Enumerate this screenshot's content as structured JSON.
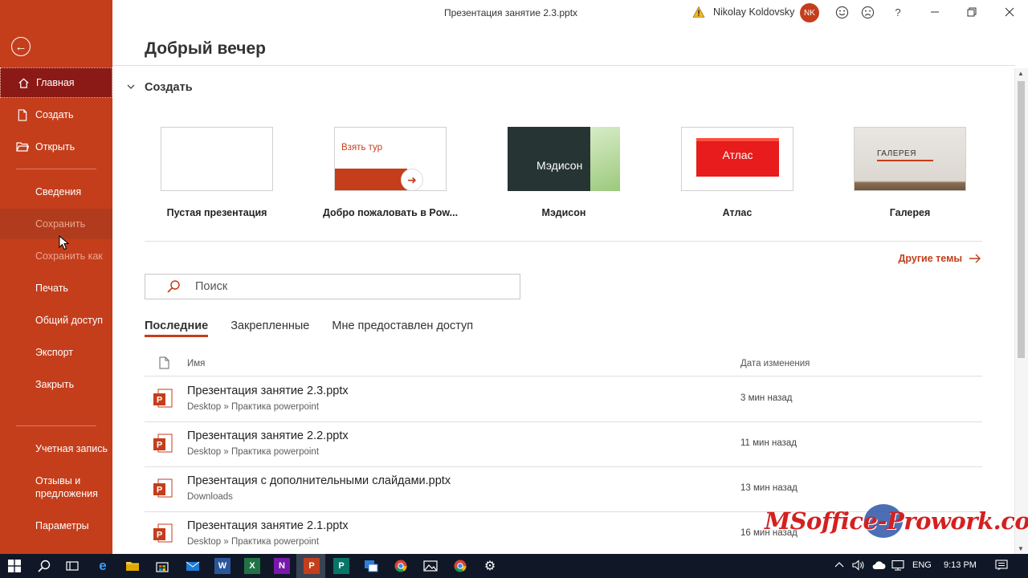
{
  "window": {
    "title": "Презентация занятие 2.3.pptx",
    "user_name": "Nikolay Koldovsky",
    "user_initials": "NK",
    "icons": [
      "warning-icon",
      "smile-icon",
      "frown-icon",
      "help-icon",
      "minimize-icon",
      "restore-icon",
      "close-icon"
    ]
  },
  "sidebar": {
    "items": [
      {
        "label": "Главная",
        "icon": "home-icon"
      },
      {
        "label": "Создать",
        "icon": "new-document-icon"
      },
      {
        "label": "Открыть",
        "icon": "folder-open-icon"
      },
      {
        "label": "Сведения"
      },
      {
        "label": "Сохранить"
      },
      {
        "label": "Сохранить как"
      },
      {
        "label": "Печать"
      },
      {
        "label": "Общий доступ"
      },
      {
        "label": "Экспорт"
      },
      {
        "label": "Закрыть"
      },
      {
        "label": "Учетная запись"
      },
      {
        "label": "Отзывы и предложения"
      },
      {
        "label": "Параметры"
      }
    ]
  },
  "main": {
    "greeting": "Добрый вечер",
    "create_section": "Создать",
    "templates": [
      {
        "caption": "Пустая презентация"
      },
      {
        "caption": "Добро пожаловать в Pow...",
        "thumb_text": "Взять тур"
      },
      {
        "caption": "Мэдисон",
        "thumb_text": "Мэдисон"
      },
      {
        "caption": "Атлас",
        "thumb_text": "Атлас"
      },
      {
        "caption": "Галерея",
        "thumb_text": "ГАЛЕРЕЯ"
      }
    ],
    "more_themes": "Другие темы",
    "search_placeholder": "Поиск",
    "tabs": [
      "Последние",
      "Закрепленные",
      "Мне предоставлен доступ"
    ],
    "list_headers": {
      "name": "Имя",
      "date": "Дата изменения"
    },
    "files": [
      {
        "name": "Презентация занятие 2.3.pptx",
        "path": "Desktop » Практика powerpoint",
        "date": "3 мин назад"
      },
      {
        "name": "Презентация занятие 2.2.pptx",
        "path": "Desktop » Практика powerpoint",
        "date": "11 мин назад"
      },
      {
        "name": "Презентация с дополнительными слайдами.pptx",
        "path": "Downloads",
        "date": "13 мин назад"
      },
      {
        "name": "Презентация занятие 2.1.pptx",
        "path": "Desktop » Практика powerpoint",
        "date": "16 мин назад"
      }
    ]
  },
  "watermark": "MSoffice-Prowork.com",
  "taskbar": {
    "language": "ENG",
    "time": "9:13 PM",
    "apps": [
      "windows-start-icon",
      "search-icon",
      "task-view-icon",
      "edge-icon",
      "file-explorer-icon",
      "store-icon",
      "mail-icon",
      "word-icon",
      "excel-icon",
      "onenote-icon",
      "powerpoint-icon",
      "publisher-icon",
      "app-icon",
      "chrome-icon",
      "photos-icon",
      "chrome-icon",
      "settings-icon"
    ]
  },
  "colors": {
    "accent": "#c43e1c",
    "sidebar_active": "#8b1a16",
    "taskbar": "#101827"
  }
}
